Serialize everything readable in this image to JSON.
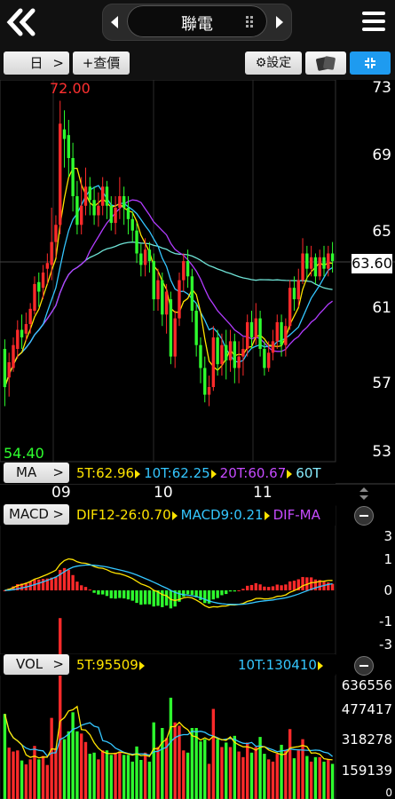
{
  "header": {
    "title": "聯電"
  },
  "toolbar": {
    "period": "日",
    "query": "+查價",
    "settings": "⚙設定"
  },
  "price_axis": {
    "labels": [
      "73",
      "69",
      "65",
      "61",
      "57",
      "53"
    ],
    "current_price": "63.60",
    "high": "72.00",
    "low": "54.40"
  },
  "ma": {
    "button": "MA",
    "v5": "5T:62.96",
    "v10": "10T:62.25",
    "v20": "20T:60.67",
    "v60": "60T"
  },
  "months": [
    "09",
    "10",
    "11"
  ],
  "macd": {
    "button": "MACD",
    "dif": "DIF12-26:0.70",
    "macd9": "MACD9:0.21",
    "difma": "DIF-MA",
    "axis": [
      "3",
      "1",
      "0",
      "-1",
      "-3"
    ]
  },
  "vol": {
    "button": "VOL",
    "v5": "5T:95509",
    "v10": "10T:130410",
    "axis": [
      "636556",
      "477417",
      "318278",
      "159139",
      "0"
    ]
  },
  "chart_data": {
    "type": "candlestick",
    "ylim": [
      53,
      73
    ],
    "candles": [
      {
        "o": 59.0,
        "c": 57.0,
        "h": 59.5,
        "l": 56.0
      },
      {
        "o": 57.5,
        "c": 58.3,
        "h": 58.8,
        "l": 56.5
      },
      {
        "o": 58.0,
        "c": 59.2,
        "h": 59.6,
        "l": 57.8
      },
      {
        "o": 59.0,
        "c": 60.0,
        "h": 60.5,
        "l": 58.5
      },
      {
        "o": 60.0,
        "c": 59.6,
        "h": 60.8,
        "l": 59.0
      },
      {
        "o": 59.8,
        "c": 60.3,
        "h": 60.9,
        "l": 59.4
      },
      {
        "o": 60.3,
        "c": 61.1,
        "h": 61.4,
        "l": 59.8
      },
      {
        "o": 61.0,
        "c": 62.4,
        "h": 62.8,
        "l": 60.8
      },
      {
        "o": 62.5,
        "c": 62.0,
        "h": 63.0,
        "l": 61.2
      },
      {
        "o": 62.2,
        "c": 63.0,
        "h": 63.4,
        "l": 61.6
      },
      {
        "o": 63.2,
        "c": 63.5,
        "h": 64.0,
        "l": 62.4
      },
      {
        "o": 63.4,
        "c": 64.6,
        "h": 66.4,
        "l": 62.6
      },
      {
        "o": 64.6,
        "c": 65.5,
        "h": 66.0,
        "l": 63.8
      },
      {
        "o": 65.5,
        "c": 70.8,
        "h": 72.0,
        "l": 65.0
      },
      {
        "o": 70.5,
        "c": 70.0,
        "h": 71.5,
        "l": 68.5
      },
      {
        "o": 70.2,
        "c": 69.0,
        "h": 71.0,
        "l": 68.0
      },
      {
        "o": 69.0,
        "c": 67.0,
        "h": 69.8,
        "l": 66.2
      },
      {
        "o": 67.0,
        "c": 65.5,
        "h": 67.8,
        "l": 65.0
      },
      {
        "o": 65.5,
        "c": 66.5,
        "h": 68.0,
        "l": 65.0
      },
      {
        "o": 66.5,
        "c": 67.5,
        "h": 68.5,
        "l": 66.0
      },
      {
        "o": 67.5,
        "c": 66.8,
        "h": 68.0,
        "l": 66.0
      },
      {
        "o": 66.8,
        "c": 66.0,
        "h": 67.5,
        "l": 65.5
      },
      {
        "o": 66.0,
        "c": 66.5,
        "h": 67.2,
        "l": 65.4
      },
      {
        "o": 66.5,
        "c": 67.5,
        "h": 68.0,
        "l": 66.0
      },
      {
        "o": 67.5,
        "c": 66.5,
        "h": 67.8,
        "l": 65.8
      },
      {
        "o": 66.5,
        "c": 65.6,
        "h": 67.0,
        "l": 65.2
      },
      {
        "o": 65.6,
        "c": 66.4,
        "h": 67.0,
        "l": 65.0
      },
      {
        "o": 66.4,
        "c": 67.0,
        "h": 68.0,
        "l": 65.8
      },
      {
        "o": 67.0,
        "c": 66.4,
        "h": 67.5,
        "l": 65.5
      },
      {
        "o": 66.4,
        "c": 65.8,
        "h": 67.0,
        "l": 65.0
      },
      {
        "o": 65.8,
        "c": 65.2,
        "h": 66.2,
        "l": 64.6
      },
      {
        "o": 65.2,
        "c": 64.0,
        "h": 65.6,
        "l": 63.5
      },
      {
        "o": 64.0,
        "c": 63.4,
        "h": 64.5,
        "l": 62.8
      },
      {
        "o": 63.4,
        "c": 64.2,
        "h": 64.8,
        "l": 62.8
      },
      {
        "o": 64.2,
        "c": 63.6,
        "h": 64.6,
        "l": 63.0
      },
      {
        "o": 63.6,
        "c": 61.6,
        "h": 64.0,
        "l": 61.0
      },
      {
        "o": 61.6,
        "c": 62.6,
        "h": 63.2,
        "l": 61.0
      },
      {
        "o": 62.6,
        "c": 60.8,
        "h": 63.0,
        "l": 60.2
      },
      {
        "o": 60.8,
        "c": 62.0,
        "h": 62.4,
        "l": 59.8
      },
      {
        "o": 61.6,
        "c": 58.6,
        "h": 62.0,
        "l": 58.2
      },
      {
        "o": 58.6,
        "c": 60.6,
        "h": 61.0,
        "l": 58.0
      },
      {
        "o": 60.6,
        "c": 62.6,
        "h": 63.0,
        "l": 60.2
      },
      {
        "o": 62.6,
        "c": 63.6,
        "h": 64.0,
        "l": 62.0
      },
      {
        "o": 63.6,
        "c": 62.8,
        "h": 64.2,
        "l": 62.2
      },
      {
        "o": 62.8,
        "c": 61.0,
        "h": 63.2,
        "l": 60.4
      },
      {
        "o": 61.0,
        "c": 59.2,
        "h": 61.4,
        "l": 58.6
      },
      {
        "o": 59.2,
        "c": 58.0,
        "h": 59.6,
        "l": 57.2
      },
      {
        "o": 58.0,
        "c": 56.6,
        "h": 58.6,
        "l": 56.2
      },
      {
        "o": 56.6,
        "c": 57.0,
        "h": 57.6,
        "l": 56.0
      },
      {
        "o": 57.0,
        "c": 59.6,
        "h": 60.2,
        "l": 56.8
      },
      {
        "o": 59.6,
        "c": 58.2,
        "h": 60.0,
        "l": 57.6
      },
      {
        "o": 58.2,
        "c": 59.2,
        "h": 59.8,
        "l": 57.6
      },
      {
        "o": 59.2,
        "c": 58.4,
        "h": 60.0,
        "l": 57.4
      },
      {
        "o": 58.4,
        "c": 59.4,
        "h": 60.0,
        "l": 57.8
      },
      {
        "o": 59.4,
        "c": 58.0,
        "h": 59.8,
        "l": 57.2
      },
      {
        "o": 58.0,
        "c": 58.6,
        "h": 59.4,
        "l": 57.2
      },
      {
        "o": 58.6,
        "c": 59.0,
        "h": 59.6,
        "l": 57.6
      },
      {
        "o": 59.0,
        "c": 60.4,
        "h": 60.8,
        "l": 58.6
      },
      {
        "o": 60.4,
        "c": 59.6,
        "h": 61.0,
        "l": 59.0
      },
      {
        "o": 59.6,
        "c": 60.6,
        "h": 61.4,
        "l": 59.2
      },
      {
        "o": 60.6,
        "c": 59.0,
        "h": 61.0,
        "l": 58.6
      },
      {
        "o": 59.0,
        "c": 58.0,
        "h": 59.4,
        "l": 57.6
      },
      {
        "o": 58.0,
        "c": 58.8,
        "h": 59.4,
        "l": 57.8
      },
      {
        "o": 58.8,
        "c": 59.4,
        "h": 60.0,
        "l": 58.4
      },
      {
        "o": 59.4,
        "c": 60.4,
        "h": 60.8,
        "l": 59.0
      },
      {
        "o": 60.4,
        "c": 59.2,
        "h": 60.8,
        "l": 58.6
      },
      {
        "o": 59.2,
        "c": 60.2,
        "h": 60.6,
        "l": 58.6
      },
      {
        "o": 60.2,
        "c": 62.2,
        "h": 62.6,
        "l": 60.0
      },
      {
        "o": 62.2,
        "c": 61.6,
        "h": 62.8,
        "l": 61.0
      },
      {
        "o": 61.6,
        "c": 62.6,
        "h": 63.2,
        "l": 61.2
      },
      {
        "o": 62.6,
        "c": 64.0,
        "h": 64.8,
        "l": 62.4
      },
      {
        "o": 64.0,
        "c": 63.2,
        "h": 64.4,
        "l": 62.6
      },
      {
        "o": 63.2,
        "c": 63.8,
        "h": 64.4,
        "l": 62.8
      },
      {
        "o": 63.8,
        "c": 62.8,
        "h": 64.0,
        "l": 62.4
      },
      {
        "o": 62.8,
        "c": 63.8,
        "h": 64.2,
        "l": 62.6
      },
      {
        "o": 63.8,
        "c": 63.2,
        "h": 64.4,
        "l": 62.8
      },
      {
        "o": 63.2,
        "c": 64.0,
        "h": 64.4,
        "l": 62.8
      },
      {
        "o": 64.0,
        "c": 63.6,
        "h": 64.6,
        "l": 63.0
      }
    ]
  }
}
